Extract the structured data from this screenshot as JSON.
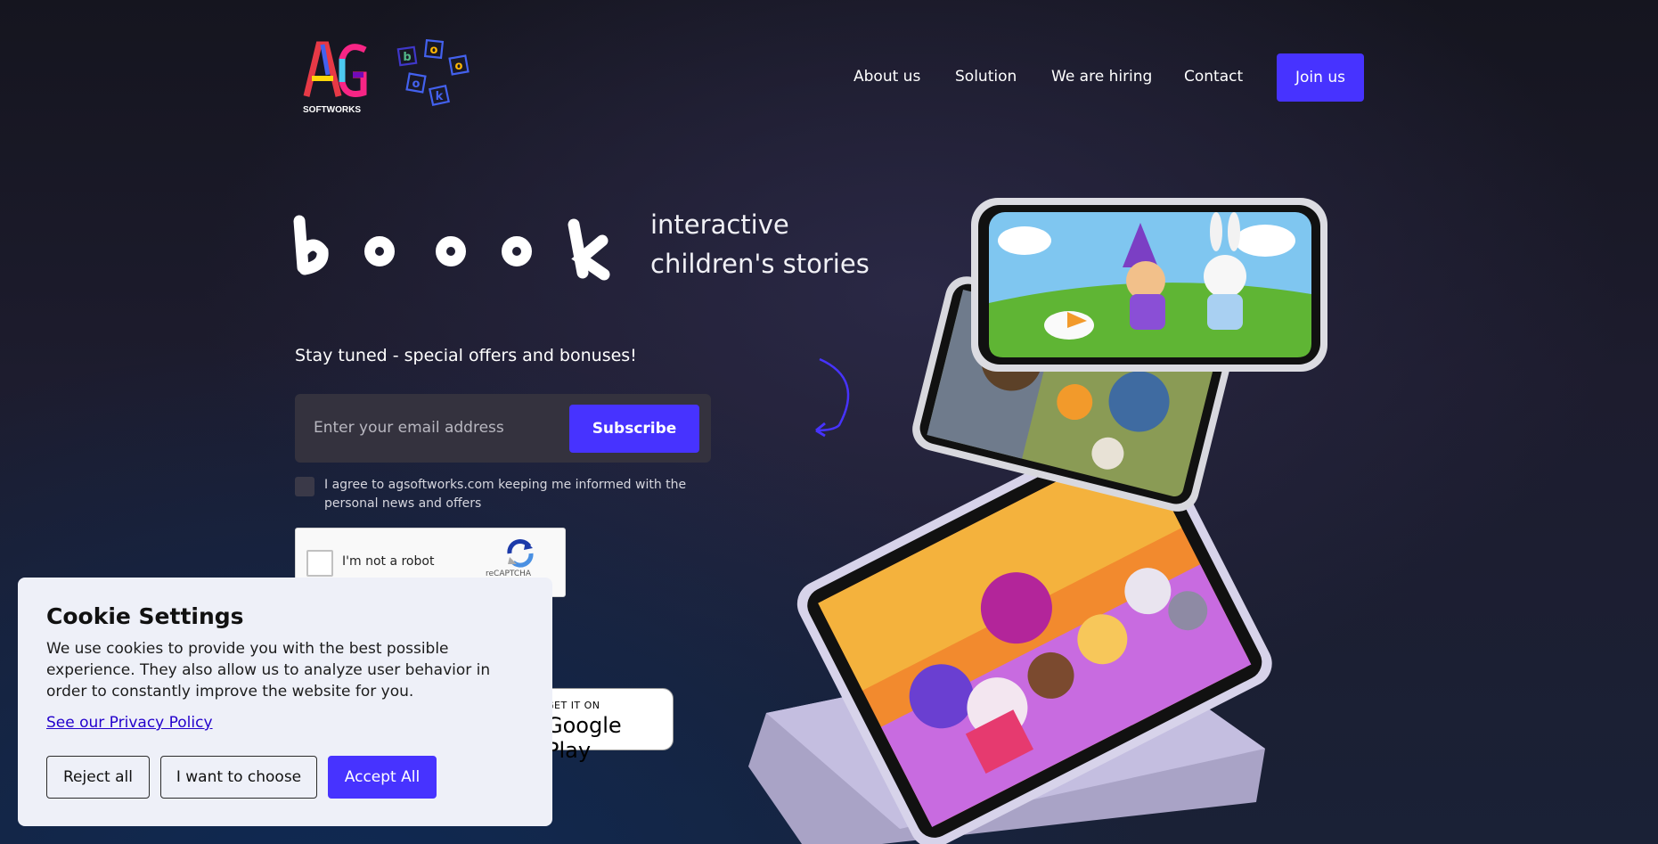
{
  "header": {
    "logo_text": "SOFTWORKS",
    "nav": [
      "About us",
      "Solution",
      "We are hiring",
      "Contact"
    ],
    "join_label": "Join us"
  },
  "hero": {
    "tagline_line1": "interactive",
    "tagline_line2": "children's stories",
    "stay_tuned": "Stay tuned - special offers and bonuses!",
    "email_placeholder": "Enter your email address",
    "subscribe_label": "Subscribe",
    "agree_text": "I agree to agsoftworks.com keeping me informed with the personal news and offers",
    "recaptcha_label": "I'm not a robot",
    "recaptcha_brand": "reCAPTCHA",
    "gplay_small": "GET IT ON",
    "gplay_big": "Google Play"
  },
  "cookie": {
    "title": "Cookie Settings",
    "body": "We use cookies to provide you with the best possible experience. They also allow us to analyze user behavior in order to constantly improve the website for you.",
    "privacy_link": "See our Privacy Policy",
    "reject_label": "Reject all",
    "choose_label": "I want to choose",
    "accept_label": "Accept All"
  },
  "colors": {
    "accent": "#4733ff",
    "panel": "#eef0f8",
    "background": "#1d1c2e"
  }
}
